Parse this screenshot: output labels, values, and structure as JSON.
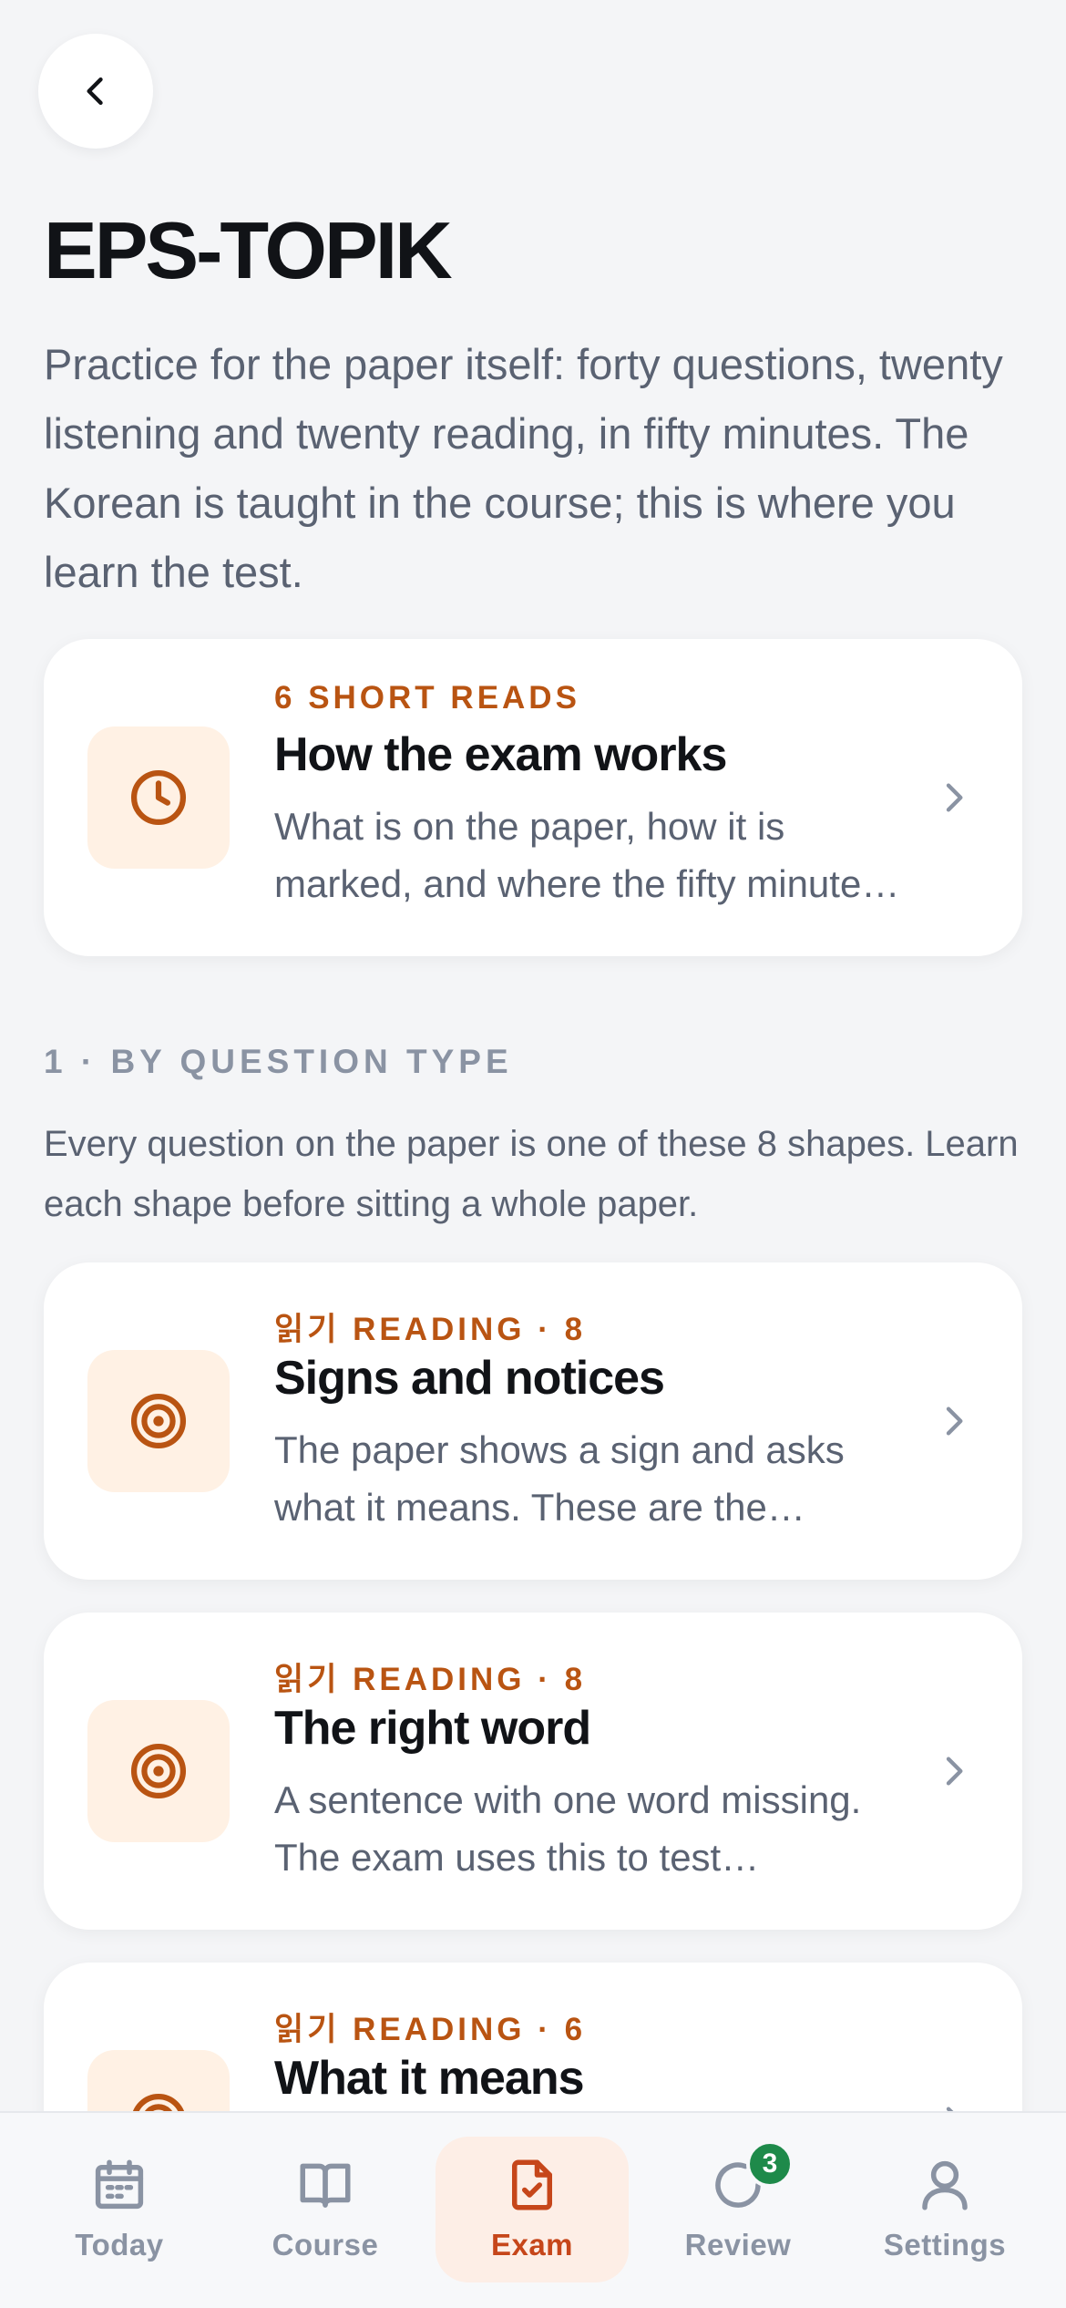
{
  "header": {
    "back_icon": "chevron-left-icon",
    "title": "EPS-TOPIK",
    "intro": "Practice for the paper itself: forty questions, twenty listening and twenty reading, in fifty minutes. The Korean is taught in the course; this is where you learn the test."
  },
  "overview_card": {
    "icon": "clock-icon",
    "eyebrow": "6 SHORT READS",
    "title": "How the exam works",
    "description": "What is on the paper, how it is marked, and where the fifty minutes go."
  },
  "section": {
    "label": "1 · BY QUESTION TYPE",
    "description": "Every question on the paper is one of these 8 shapes. Learn each shape before sitting a whole paper."
  },
  "question_types": [
    {
      "icon": "target-icon",
      "eyebrow": "읽기 READING · 8",
      "title": "Signs and notices",
      "description": "The paper shows a sign and asks what it means. These are the quickest marks on the paper."
    },
    {
      "icon": "target-icon",
      "eyebrow": "읽기 READING · 8",
      "title": "The right word",
      "description": "A sentence with one word missing. The exam uses this to test vocabulary in context."
    },
    {
      "icon": "target-icon",
      "eyebrow": "읽기 READING · 6",
      "title": "What it means",
      "description": ""
    }
  ],
  "tab_bar": {
    "tabs": [
      {
        "label": "Today",
        "icon": "calendar-icon",
        "active": false
      },
      {
        "label": "Course",
        "icon": "book-icon",
        "active": false
      },
      {
        "label": "Exam",
        "icon": "document-check-icon",
        "active": true
      },
      {
        "label": "Review",
        "icon": "refresh-icon",
        "active": false,
        "badge": "3"
      },
      {
        "label": "Settings",
        "icon": "user-icon",
        "active": false
      }
    ]
  },
  "colors": {
    "accent": "#b95412",
    "active_tab": "#c6461a",
    "badge": "#1e8a4a",
    "background": "#f4f5f7"
  }
}
